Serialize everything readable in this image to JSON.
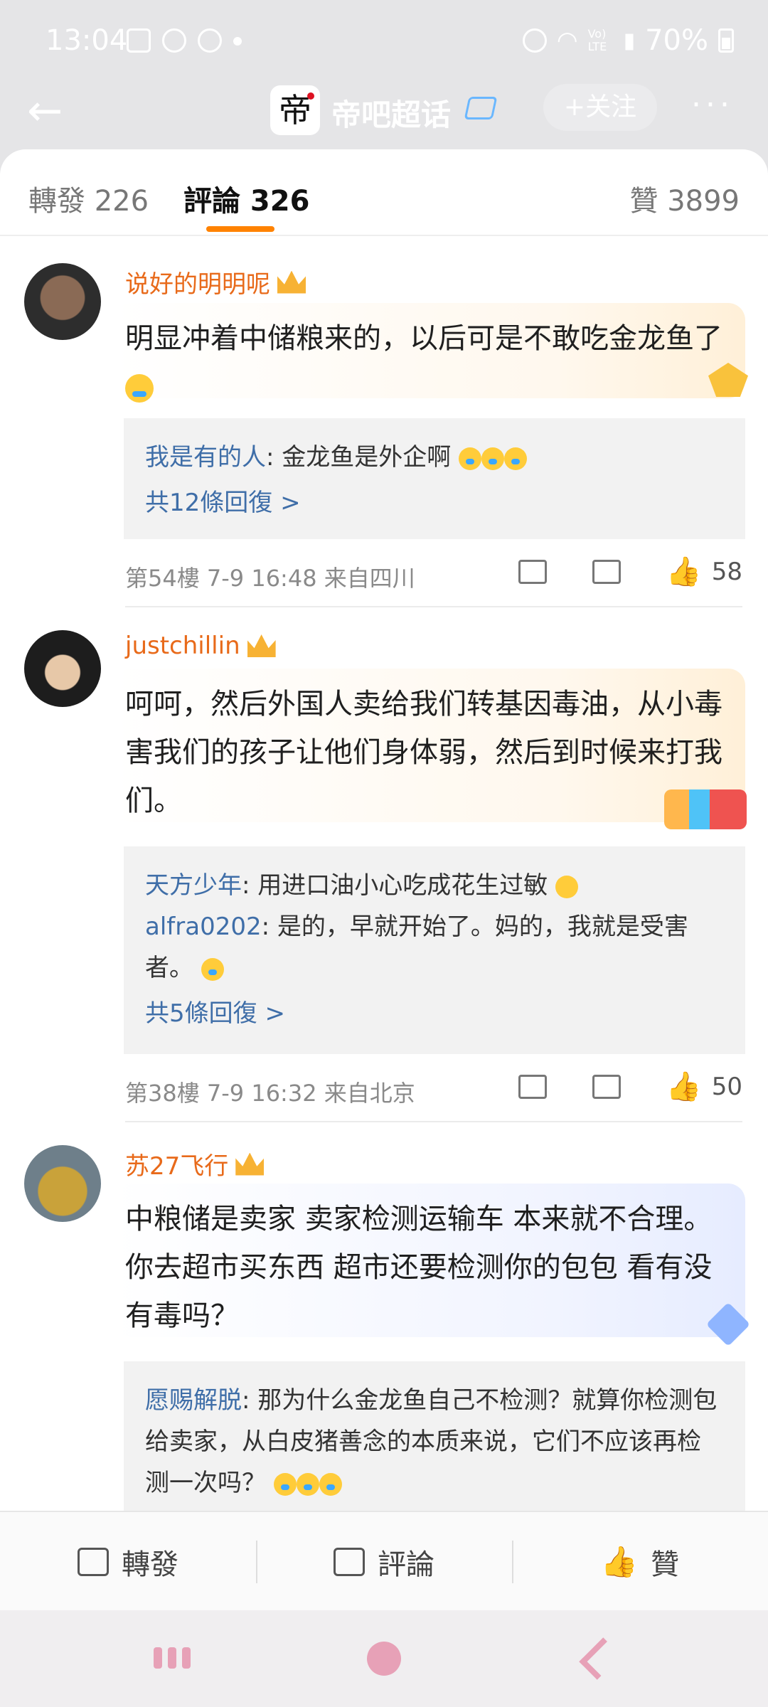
{
  "status_bar": {
    "time": "13:04",
    "battery": "70%",
    "network": "Vo) LTE"
  },
  "nav": {
    "title": "帝吧超话",
    "logo_char": "帝",
    "follow_label": "+关注",
    "more": "···"
  },
  "tabs": {
    "repost": "轉發 226",
    "comment": "評論 326",
    "like": "贊 3899"
  },
  "comments": [
    {
      "user": "说好的明明呢",
      "text": "明显冲着中储粮来的，以后可是不敢吃金龙鱼了",
      "replies": [
        {
          "name": "我是有的人",
          "text": ": 金龙鱼是外企啊"
        }
      ],
      "reply_more": "共12條回復 >",
      "meta": "第54樓  7-9 16:48  来自四川",
      "likes": "58"
    },
    {
      "user": "justchillin",
      "text": "呵呵，然后外国人卖给我们转基因毒油，从小毒害我们的孩子让他们身体弱，然后到时候来打我们。",
      "replies": [
        {
          "name": "天方少年",
          "text": ": 用进口油小心吃成花生过敏"
        },
        {
          "name": "alfra0202",
          "text": ": 是的，早就开始了。妈的，我就是受害者。"
        }
      ],
      "reply_more": "共5條回復 >",
      "meta": "第38樓  7-9 16:32  来自北京",
      "likes": "50"
    },
    {
      "user": "苏27飞行",
      "text": "中粮储是卖家 卖家检测运输车 本来就不合理。你去超市买东西 超市还要检测你的包包 看有没有毒吗？",
      "replies": [
        {
          "name": "愿赐解脱",
          "text": ": 那为什么金龙鱼自己不检测？就算你检测包给卖家，从白皮猪善念的本质来说，它们不应该再检测一次吗？"
        }
      ]
    }
  ],
  "bottom_bar": {
    "repost": "轉發",
    "comment": "評論",
    "like": "贊"
  }
}
